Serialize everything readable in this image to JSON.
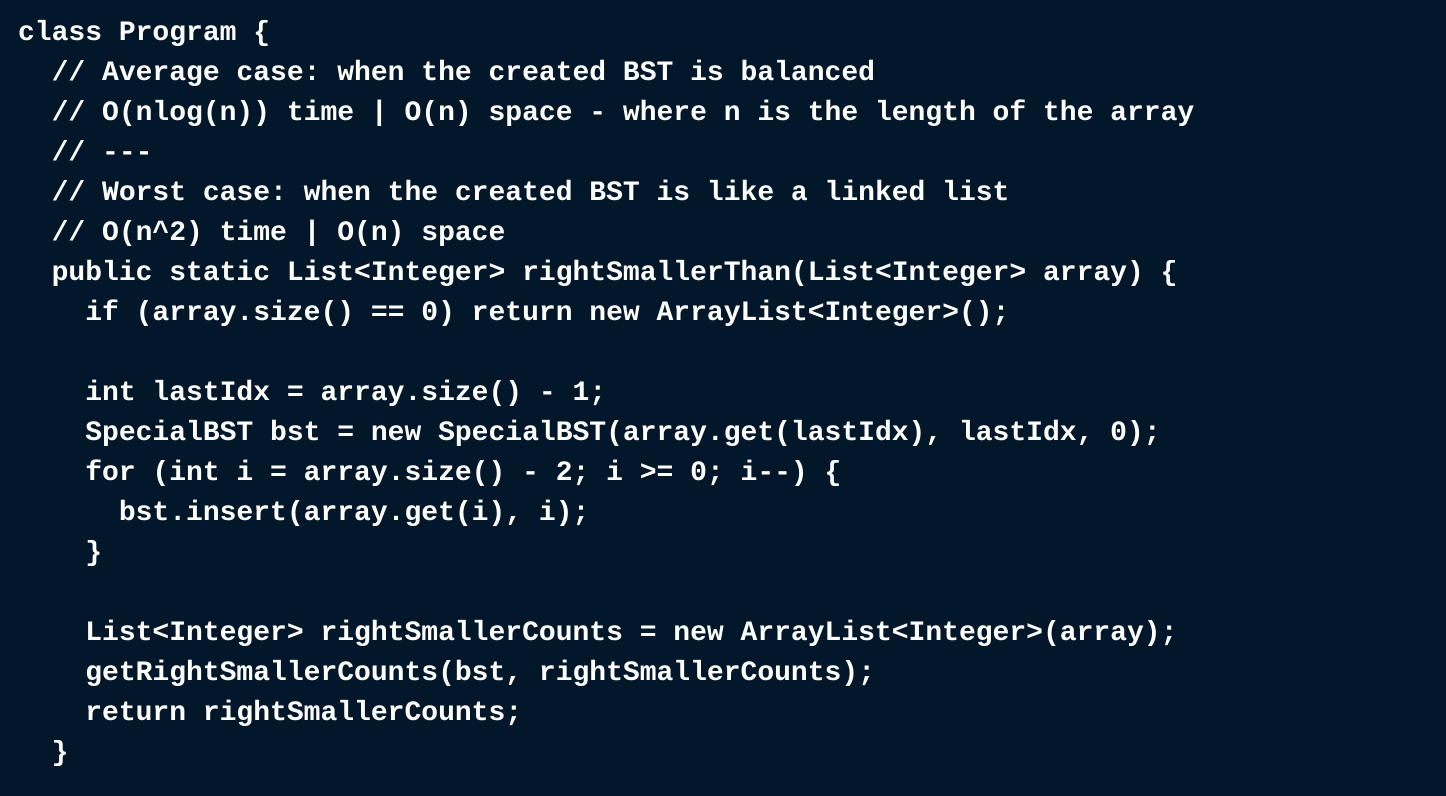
{
  "code": {
    "lines": [
      "class Program {",
      "  // Average case: when the created BST is balanced",
      "  // O(nlog(n)) time | O(n) space - where n is the length of the array",
      "  // ---",
      "  // Worst case: when the created BST is like a linked list",
      "  // O(n^2) time | O(n) space",
      "  public static List<Integer> rightSmallerThan(List<Integer> array) {",
      "    if (array.size() == 0) return new ArrayList<Integer>();",
      "",
      "    int lastIdx = array.size() - 1;",
      "    SpecialBST bst = new SpecialBST(array.get(lastIdx), lastIdx, 0);",
      "    for (int i = array.size() - 2; i >= 0; i--) {",
      "      bst.insert(array.get(i), i);",
      "    }",
      "",
      "    List<Integer> rightSmallerCounts = new ArrayList<Integer>(array);",
      "    getRightSmallerCounts(bst, rightSmallerCounts);",
      "    return rightSmallerCounts;",
      "  }"
    ]
  },
  "colors": {
    "background": "#02172a",
    "text": "#ffffff"
  }
}
